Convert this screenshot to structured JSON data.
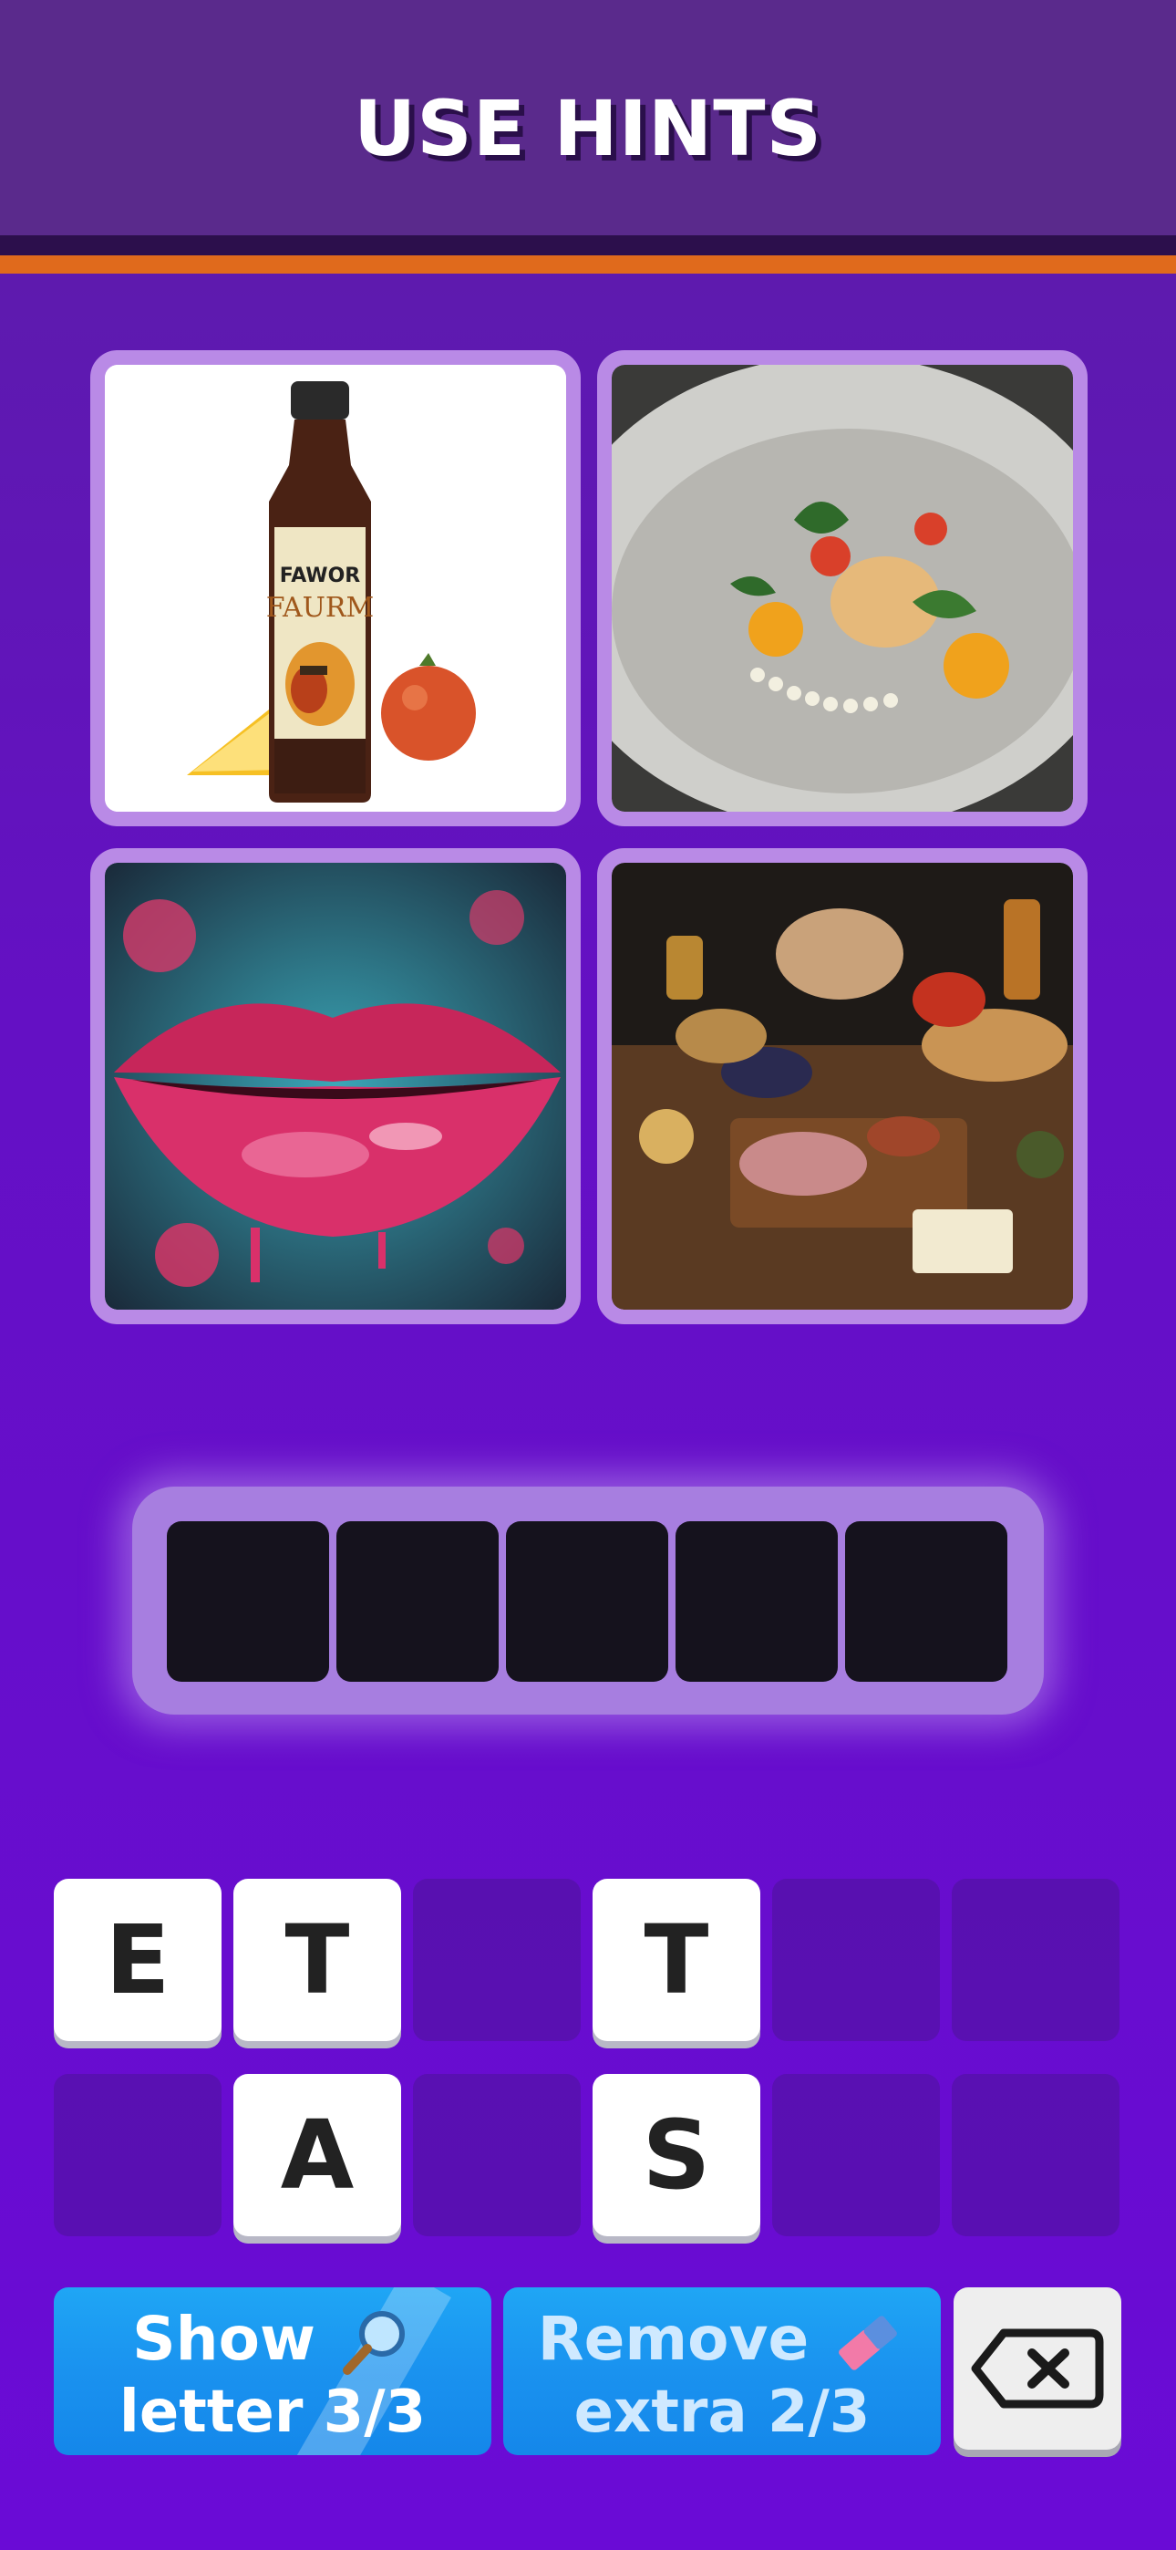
{
  "header": {
    "title": "USE HINTS"
  },
  "photos": [
    {
      "subject": "sauce bottle with lemon and tomato",
      "bottle_label_top": "FAWOR",
      "bottle_label_main": "FAURM"
    },
    {
      "subject": "plated gourmet dish"
    },
    {
      "subject": "painted glossy red lips"
    },
    {
      "subject": "table of food spread"
    }
  ],
  "answer": {
    "slots": 5,
    "letters": [
      "",
      "",
      "",
      "",
      ""
    ]
  },
  "letter_tiles": {
    "row1": [
      "E",
      "T",
      "",
      "T",
      "",
      ""
    ],
    "row2": [
      "",
      "A",
      "",
      "S",
      "",
      ""
    ]
  },
  "hints": {
    "show_letter": {
      "line1": "Show",
      "line2": "letter 3/3",
      "icon": "magnifier-icon"
    },
    "remove_extra": {
      "line1": "Remove",
      "line2": "extra 2/3",
      "icon": "eraser-icon"
    },
    "backspace": {
      "icon": "backspace-icon"
    }
  },
  "colors": {
    "header": "#5a2a8c",
    "orange_stripe": "#e06a1c",
    "tile_border": "#b98ae6",
    "hint_button": "#1a92ef"
  }
}
